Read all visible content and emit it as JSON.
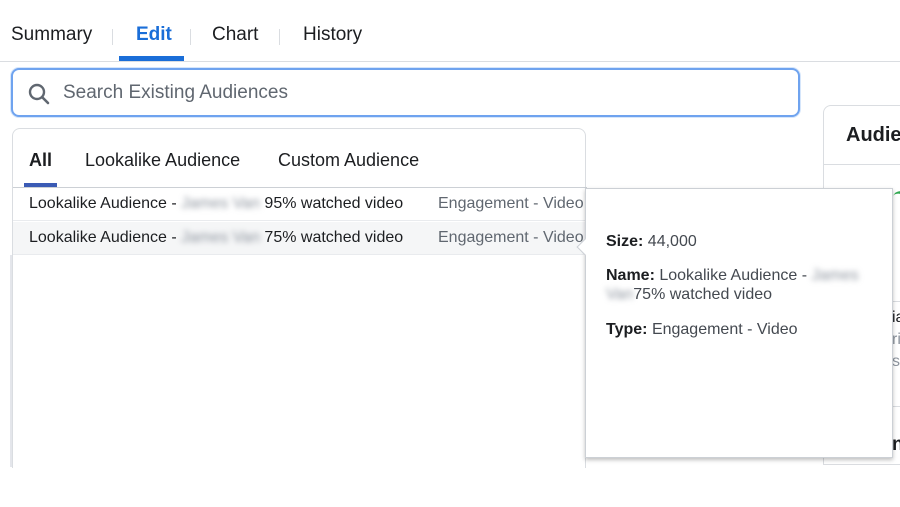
{
  "top_tabs": [
    {
      "label": "Summary",
      "active": false
    },
    {
      "label": "Edit",
      "active": true
    },
    {
      "label": "Chart",
      "active": false
    },
    {
      "label": "History",
      "active": false
    }
  ],
  "search": {
    "placeholder": "Search Existing Audiences",
    "value": "",
    "icon": "search-icon"
  },
  "audience_filter_tabs": [
    {
      "label": "All",
      "active": true
    },
    {
      "label": "Lookalike Audience",
      "active": false
    },
    {
      "label": "Custom Audience",
      "active": false
    }
  ],
  "audiences": [
    {
      "prefix": "Lookalike Audience - ",
      "redacted": "James Van",
      "suffix": "95% watched video",
      "type": "Engagement - Video",
      "hovered": false
    },
    {
      "prefix": "Lookalike Audience - ",
      "redacted": "James Van",
      "suffix": "75% watched video",
      "type": "Engagement - Video",
      "hovered": true
    }
  ],
  "tooltip": {
    "size_label": "Size:",
    "size_value": "44,000",
    "name_label": "Name:",
    "name_prefix": "Lookalike Audience - ",
    "name_redacted_1": "James",
    "name_redacted_2": "Van",
    "name_suffix": "75% watched video",
    "type_label": "Type:",
    "type_value": "Engagement - Video"
  },
  "right_panel": {
    "title": "Audie",
    "frag_1": "ia",
    "frag_2": "ri",
    "frag_3": "si",
    "frag_4": "n"
  },
  "colors": {
    "accent": "#1a6ed8",
    "tab_underline": "#3b5bb5",
    "search_border": "#6fa3ef"
  }
}
